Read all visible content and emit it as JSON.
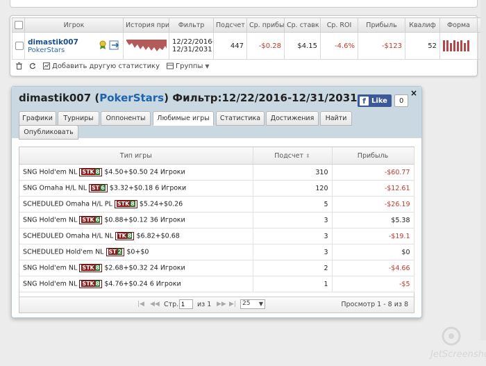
{
  "player_table": {
    "headers": [
      "Игрок",
      "История при",
      "Фильтр",
      "Подсчет",
      "Ср. прибы",
      "Ср. ставк",
      "Ср. ROI",
      "Прибыль",
      "Квалиф",
      "Форма"
    ],
    "row": {
      "name": "dimastik007",
      "site": "PokerStars",
      "filter_line1": "12/22/2016-",
      "filter_line2": "12/31/2031",
      "count": "447",
      "avg_profit": "-$0.28",
      "avg_stake": "$4.15",
      "avg_roi": "-4.6%",
      "profit": "-$123",
      "qualif": "52",
      "remove": "x"
    },
    "toolbar": {
      "add_stat": "Добавить другую статистику",
      "groups": "Группы"
    }
  },
  "dialog": {
    "title_name": "dimastik007",
    "title_site": "PokerStars",
    "title_filter": "Фильтр:12/22/2016-12/31/2031",
    "fb_like": "Like",
    "fb_count": "0",
    "close": "×",
    "tabs": [
      "Графики",
      "Турниры",
      "Оппоненты",
      "Любимые игры",
      "Статистика",
      "Достижения",
      "Найти",
      "Опубликовать"
    ],
    "active_tab": "Любимые игры",
    "grid": {
      "headers": [
        "Тип игры",
        "Подсчет",
        "Прибыль"
      ],
      "rows": [
        {
          "prefix": "SNG Hold'em NL",
          "badge": "STK",
          "badge_num": "8",
          "detail": "$4.50+$0.50 24 Игроки",
          "count": "310",
          "profit": "-$60.77",
          "neg": true
        },
        {
          "prefix": "SNG Omaha H/L NL",
          "badge": "ST",
          "badge_num": "6",
          "detail": "$3.32+$0.18 6 Игроки",
          "count": "120",
          "profit": "-$12.61",
          "neg": true
        },
        {
          "prefix": "SCHEDULED Omaha H/L PL",
          "badge": "STK",
          "badge_num": "8",
          "detail": "$5.24+$0.26",
          "count": "5",
          "profit": "-$26.19",
          "neg": true
        },
        {
          "prefix": "SNG Hold'em NL",
          "badge": "STK",
          "badge_num": "6",
          "detail": "$0.88+$0.12 36 Игроки",
          "count": "3",
          "profit": "$5.38",
          "neg": false
        },
        {
          "prefix": "SCHEDULED Omaha H/L NL",
          "badge": "TK",
          "badge_num": "8",
          "detail": "$6.82+$0.68",
          "count": "3",
          "profit": "-$19.1",
          "neg": true
        },
        {
          "prefix": "SCHEDULED Hold'em NL",
          "badge": "ST",
          "badge_num": "2",
          "detail": "$0+$0",
          "count": "3",
          "profit": "$0",
          "neg": false
        },
        {
          "prefix": "SNG Hold'em NL",
          "badge": "STK",
          "badge_num": "8",
          "detail": "$2.68+$0.32 24 Игроки",
          "count": "2",
          "profit": "-$4.66",
          "neg": true
        },
        {
          "prefix": "SNG Hold'em NL",
          "badge": "STK",
          "badge_num": "8",
          "detail": "$4.76+$0.24 6 Игроки",
          "count": "1",
          "profit": "-$5",
          "neg": true
        }
      ]
    },
    "pager": {
      "page_label": "Стр.",
      "page_value": "1",
      "of_label": "из 1",
      "page_size": "25",
      "view_text": "Просмотр 1 - 8 из 8"
    }
  },
  "colors": {
    "negative": "#c0392b",
    "link": "#1d63ad",
    "dialog_header": "#c9d8e1",
    "fb_blue": "#3b5998"
  },
  "watermark": "JetScreenshot"
}
